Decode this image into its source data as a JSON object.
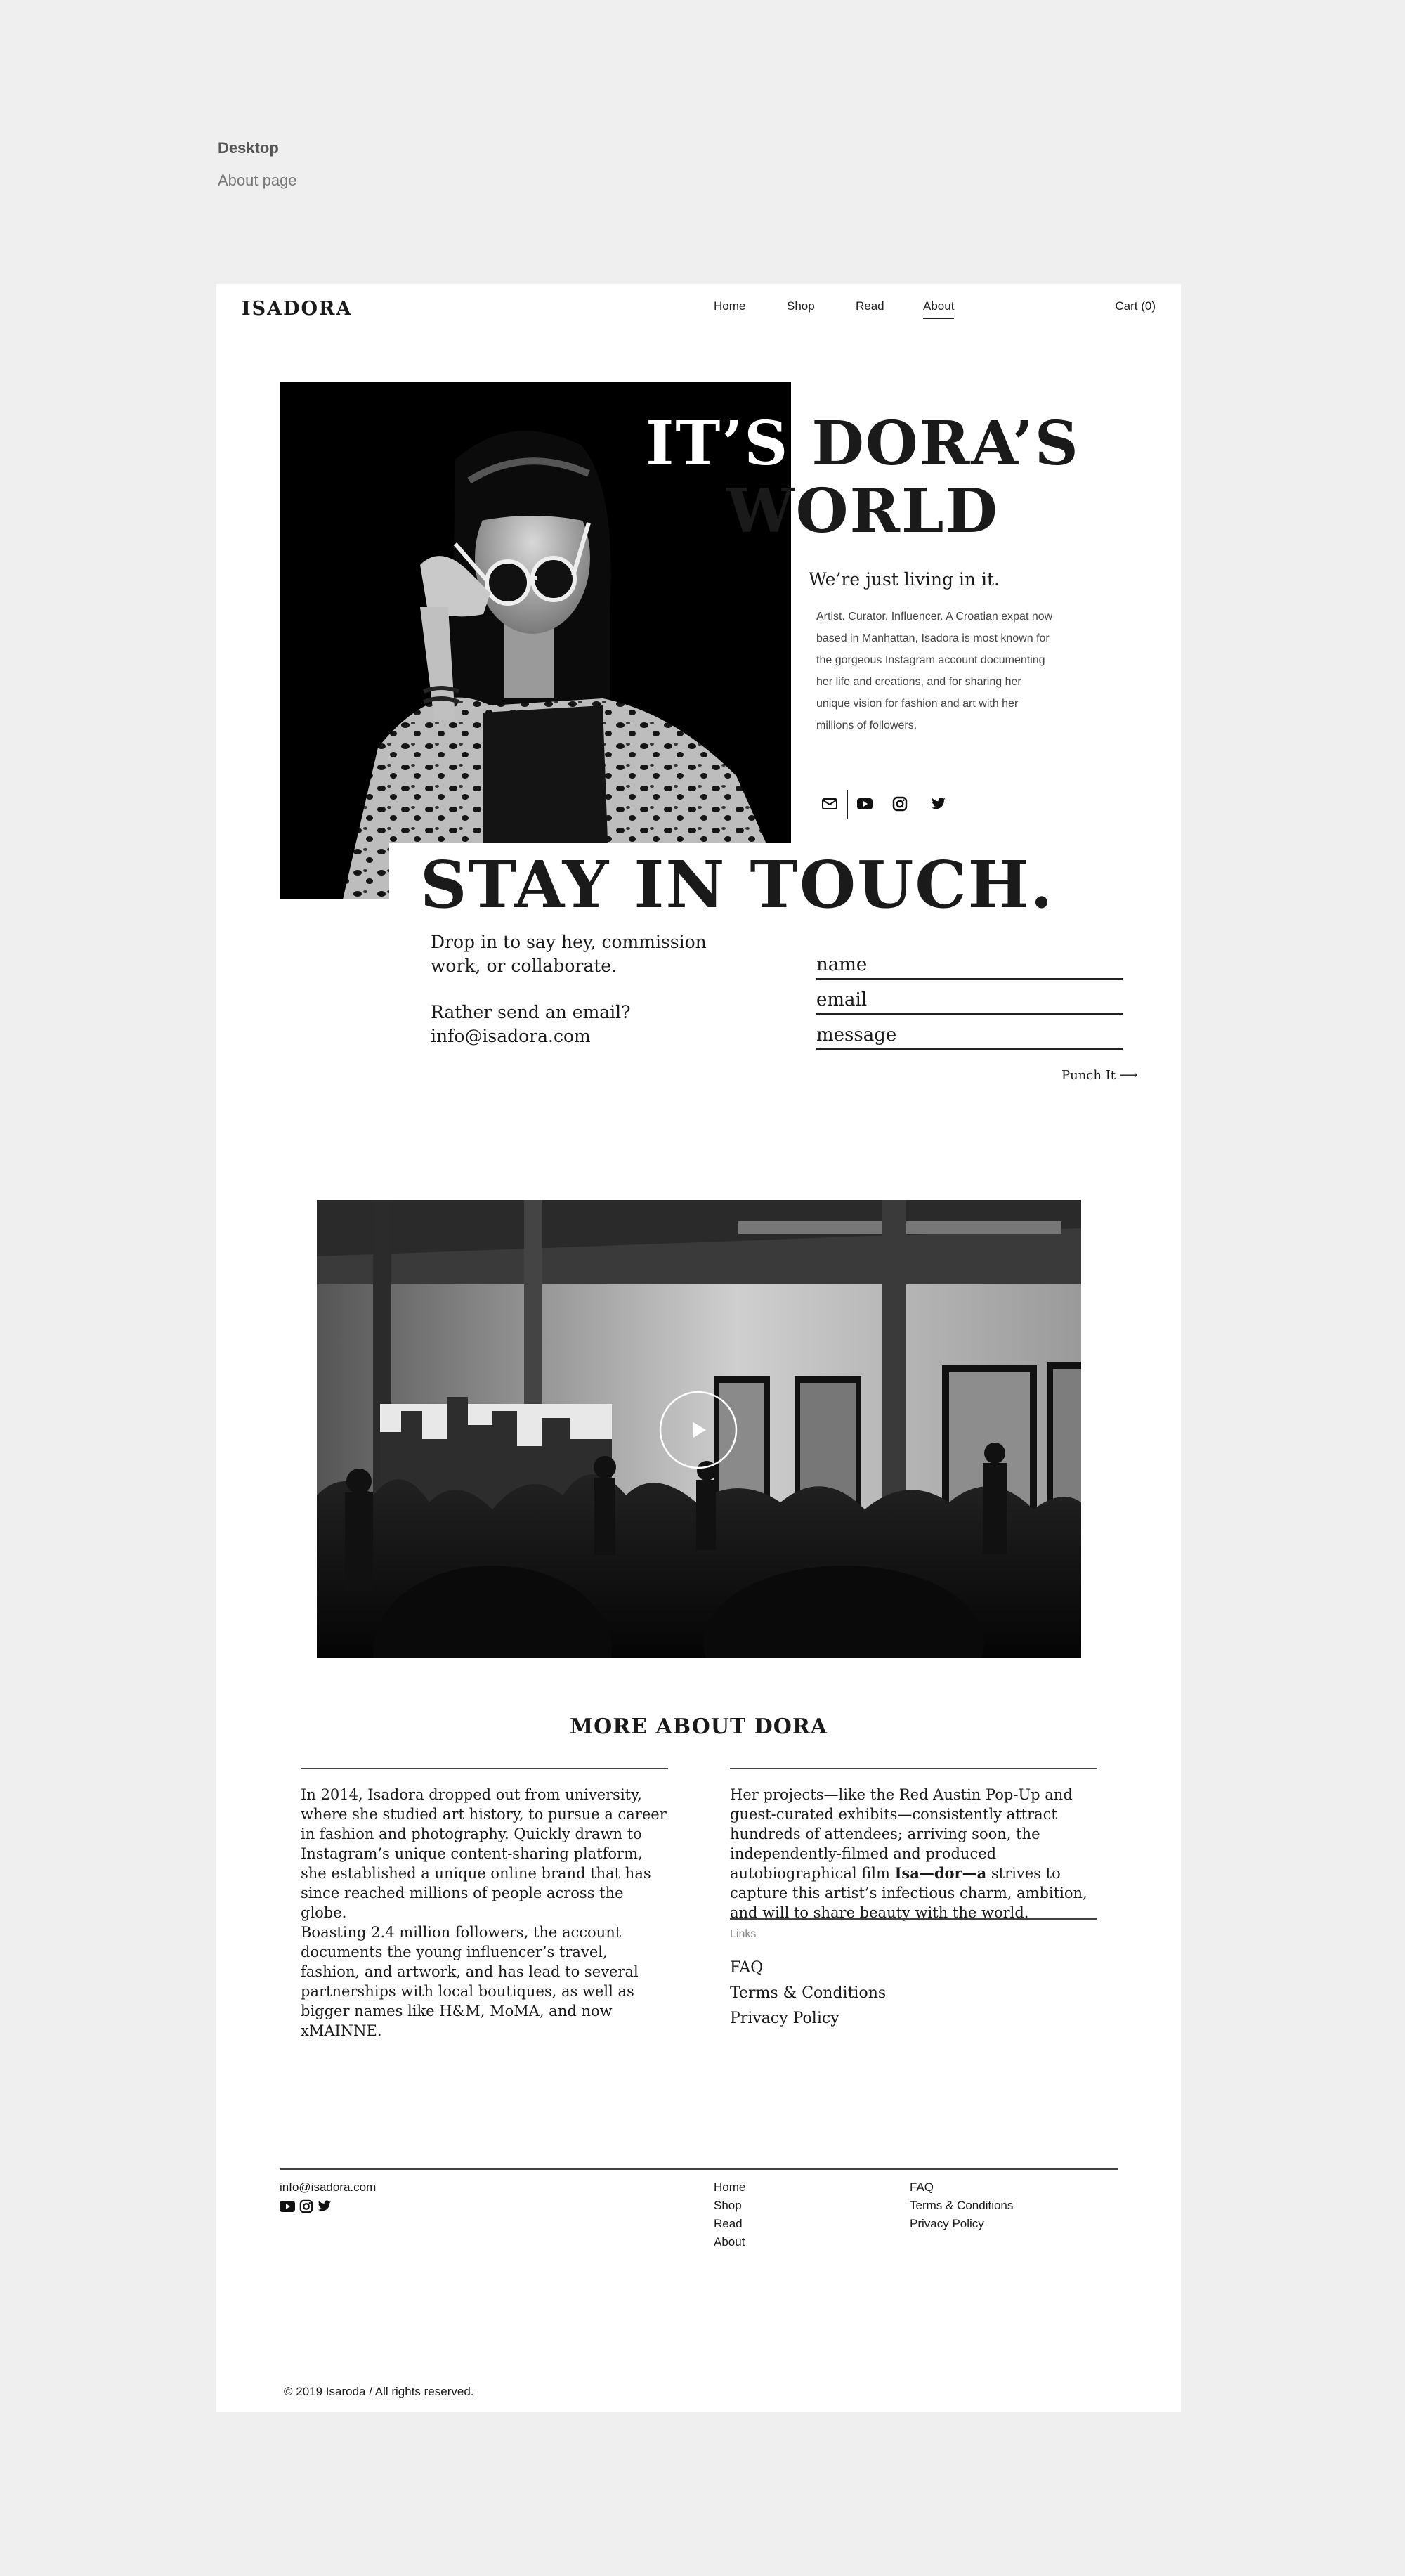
{
  "annotation": {
    "title": "Desktop",
    "subtitle": "About page"
  },
  "nav": {
    "logo": "ISADORA",
    "items": [
      "Home",
      "Shop",
      "Read",
      "About"
    ],
    "cart": "Cart (0)"
  },
  "hero": {
    "title_line1_a": "IT’S",
    "title_line1_b": "DORA’S",
    "title_line2": "WORLD",
    "tagline": "We’re just living in it.",
    "description": "Artist. Curator. Influencer. A Croatian expat now based in Manhattan, Isadora is most known for the gorgeous Instagram account documenting her life and creations, and for sharing her unique vision for fashion and art with her millions of followers.",
    "socials": [
      "mail-icon",
      "youtube-icon",
      "instagram-icon",
      "twitter-icon"
    ]
  },
  "contact": {
    "title": "STAY IN TOUCH.",
    "text1": "Drop in to say hey, commission work, or collaborate.",
    "text2_line1": "Rather send an email?",
    "text2_line2": "info@isadora.com",
    "fields": {
      "name": "name",
      "email": "email",
      "message": "message"
    },
    "submit": "Punch It ⟶"
  },
  "video": {
    "play_icon": "play-icon"
  },
  "about": {
    "title": "MORE ABOUT DORA",
    "col1_p1": "In 2014, Isadora dropped out from university, where she studied art history, to pursue a career in fashion and photography. Quickly drawn to Instagram’s unique content-sharing platform, she established a unique online brand that has since reached millions of people across the globe.",
    "col1_p2": "Boasting 2.4 million followers, the account documents the young influencer’s travel, fashion, and artwork, and has lead to several partnerships with local boutiques, as well as bigger names like H&M, MoMA, and now xMAINNE.",
    "col2_p1_a": "Her projects—like the Red Austin Pop-Up and guest-curated exhibits—consistently attract hundreds of attendees; arriving soon, the independently-filmed and produced autobiographical film ",
    "col2_p1_film": "Isa—dor—a",
    "col2_p1_b": " strives to capture this artist’s infectious charm, ambition, and will to share beauty with the world.",
    "links_label": "Links",
    "links": [
      "FAQ",
      "Terms & Conditions",
      "Privacy Policy"
    ]
  },
  "footer": {
    "email": "info@isadora.com",
    "nav": [
      "Home",
      "Shop",
      "Read",
      "About"
    ],
    "legal": [
      "FAQ",
      "Terms & Conditions",
      "Privacy Policy"
    ],
    "copyright": "© 2019 Isaroda / All rights reserved."
  },
  "colors": {
    "page_bg": "#efefef",
    "card_bg": "#ffffff",
    "ink": "#1a1a1a"
  }
}
